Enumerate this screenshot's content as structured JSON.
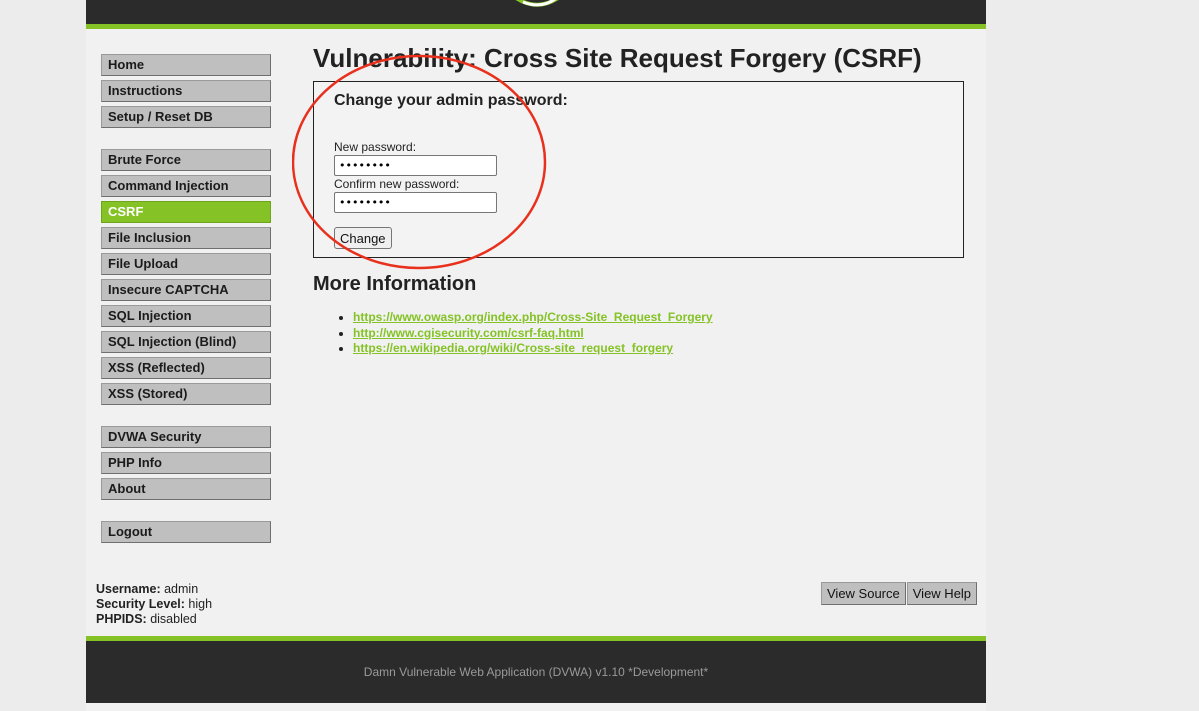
{
  "menu": {
    "group1": [
      {
        "label": "Home"
      },
      {
        "label": "Instructions"
      },
      {
        "label": "Setup / Reset DB"
      }
    ],
    "group2": [
      {
        "label": "Brute Force"
      },
      {
        "label": "Command Injection"
      },
      {
        "label": "CSRF"
      },
      {
        "label": "File Inclusion"
      },
      {
        "label": "File Upload"
      },
      {
        "label": "Insecure CAPTCHA"
      },
      {
        "label": "SQL Injection"
      },
      {
        "label": "SQL Injection (Blind)"
      },
      {
        "label": "XSS (Reflected)"
      },
      {
        "label": "XSS (Stored)"
      }
    ],
    "group3": [
      {
        "label": "DVWA Security"
      },
      {
        "label": "PHP Info"
      },
      {
        "label": "About"
      }
    ],
    "group4": [
      {
        "label": "Logout"
      }
    ],
    "selected": "CSRF"
  },
  "main": {
    "title": "Vulnerability: Cross Site Request Forgery (CSRF)",
    "form": {
      "heading": "Change your admin password:",
      "new_password_label": "New password:",
      "new_password_value": "••••••••",
      "confirm_password_label": "Confirm new password:",
      "confirm_password_value": "••••••••",
      "submit_label": "Change"
    },
    "more_info": {
      "title": "More Information",
      "links": [
        "https://www.owasp.org/index.php/Cross-Site_Request_Forgery",
        "http://www.cgisecurity.com/csrf-faq.html",
        "https://en.wikipedia.org/wiki/Cross-site_request_forgery"
      ]
    }
  },
  "userinfo": {
    "username_label": "Username:",
    "username": "admin",
    "security_label": "Security Level:",
    "security": "high",
    "phpids_label": "PHPIDS:",
    "phpids": "disabled"
  },
  "buttons": {
    "view_source": "View Source",
    "view_help": "View Help"
  },
  "footer": {
    "text": "Damn Vulnerable Web Application (DVWA) v1.10 *Development*"
  },
  "colors": {
    "accent": "#84c225",
    "header_bg": "#2b2b2b",
    "annotation": "#e8301c"
  }
}
